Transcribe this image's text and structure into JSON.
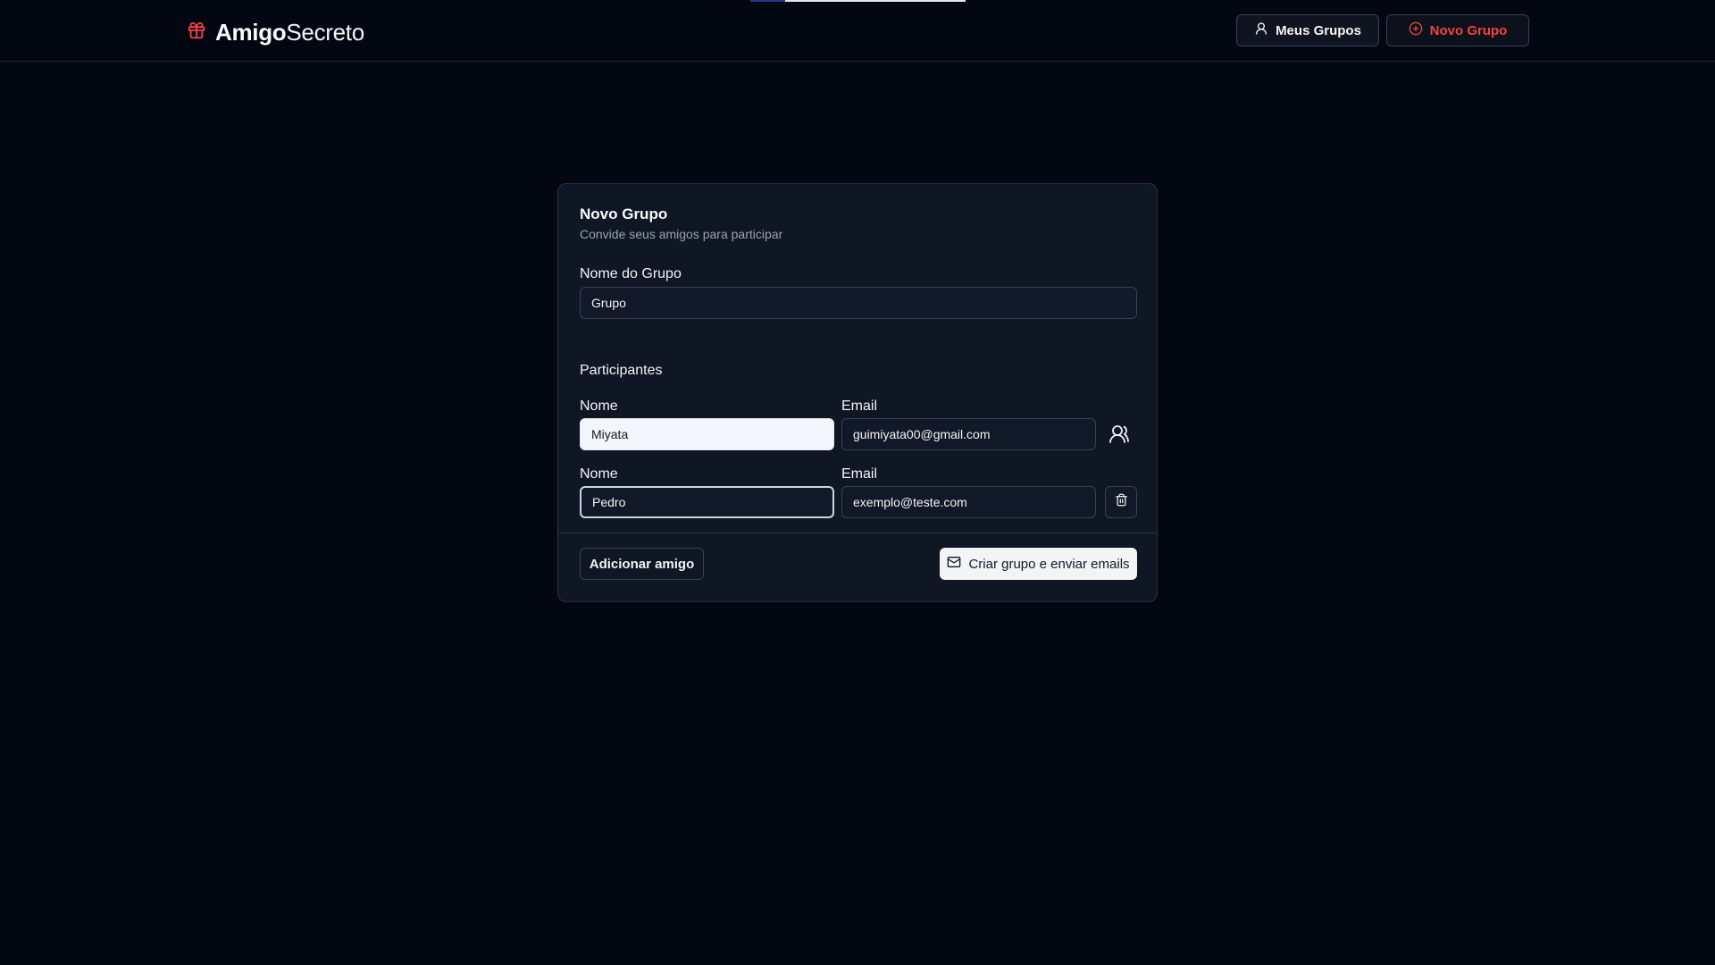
{
  "app": {
    "logo_bold": "Amigo",
    "logo_light": "Secreto",
    "logo_icon": "gift-icon",
    "accent_color": "#ef4444",
    "loading_progress": 0.16
  },
  "nav": {
    "my_groups_label": "Meus Grupos",
    "my_groups_icon": "user-icon",
    "new_group_label": "Novo Grupo",
    "new_group_icon": "plus-circle-icon"
  },
  "card": {
    "title": "Novo Grupo",
    "subtitle": "Convide seus amigos para participar",
    "group_name_label": "Nome do Grupo",
    "group_name_value": "Grupo",
    "participants_title": "Participantes",
    "participants": [
      {
        "name_label": "Nome",
        "name_value": "Miyata",
        "email_label": "Email",
        "email_value": "guimiyata00@gmail.com",
        "action_icon": "users-icon"
      },
      {
        "name_label": "Nome",
        "name_value": "Pedro",
        "email_label": "Email",
        "email_value": "exemplo@teste.com",
        "action_icon": "trash-icon"
      }
    ],
    "add_friend_label": "Adicionar amigo",
    "create_label": "Criar grupo e enviar emails",
    "create_icon": "mail-icon"
  }
}
